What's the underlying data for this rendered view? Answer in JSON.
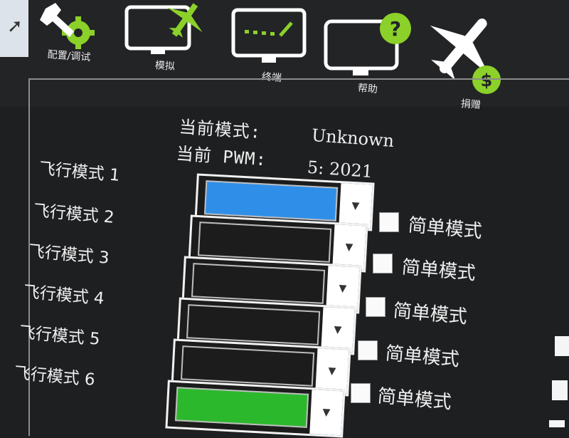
{
  "toolbar": {
    "items": [
      {
        "label": "配置/调试",
        "icon": "wrench-gear-icon"
      },
      {
        "label": "模拟",
        "icon": "monitor-plane-icon"
      },
      {
        "label": "终端",
        "icon": "terminal-icon"
      },
      {
        "label": "帮助",
        "icon": "help-monitor-icon"
      },
      {
        "label": "捐赠",
        "icon": "plane-dollar-icon"
      }
    ]
  },
  "status": {
    "mode_label": "当前模式:",
    "mode_value": "Unknown",
    "pwm_label": "当前 PWM:",
    "pwm_value": "5: 2021"
  },
  "flight_modes": [
    {
      "label": "飞行模式 1",
      "selected": "",
      "highlight": "#2f8fe8"
    },
    {
      "label": "飞行模式 2",
      "selected": "",
      "simple_label": "简单模式",
      "simple_checked": false
    },
    {
      "label": "飞行模式 3",
      "selected": "",
      "simple_label": "简单模式",
      "simple_checked": false
    },
    {
      "label": "飞行模式 4",
      "selected": "",
      "simple_label": "简单模式",
      "simple_checked": false
    },
    {
      "label": "飞行模式 5",
      "selected": "",
      "simple_label": "简单模式",
      "simple_checked": false
    },
    {
      "label": "飞行模式 6",
      "selected": "",
      "simple_label": "简单模式",
      "simple_checked": false
    }
  ],
  "colors": {
    "accent_green": "#8bd12a",
    "highlight_blue": "#2f8fe8",
    "highlight_green": "#2cb82c"
  }
}
